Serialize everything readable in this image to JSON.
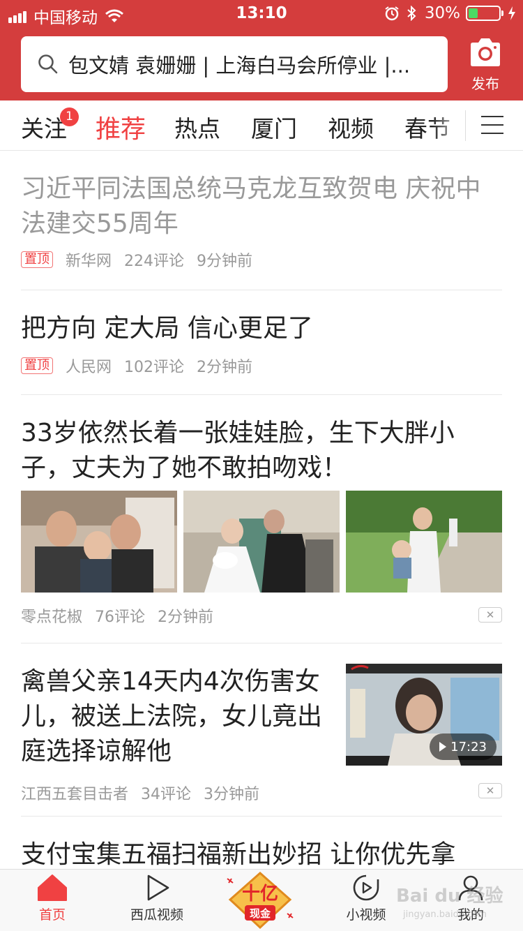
{
  "status_bar": {
    "carrier": "中国移动",
    "time": "13:10",
    "battery": "30%"
  },
  "header": {
    "search_text": "包文婧 袁姗姗 | 上海白马会所停业 |...",
    "publish_label": "发布"
  },
  "channels": {
    "items": [
      "关注",
      "推荐",
      "热点",
      "厦门",
      "视频",
      "春节"
    ],
    "active": "推荐",
    "follow_badge": "1"
  },
  "feed": [
    {
      "title": "习近平同法国总统马克龙互致贺电 庆祝中法建交55周年",
      "tag": "置顶",
      "source": "新华网",
      "comments": "224评论",
      "time": "9分钟前",
      "read": true
    },
    {
      "title": "把方向 定大局 信心更足了",
      "tag": "置顶",
      "source": "人民网",
      "comments": "102评论",
      "time": "2分钟前"
    },
    {
      "title": "33岁依然长着一张娃娃脸，生下大胖小子，丈夫为了她不敢拍吻戏！",
      "source": "零点花椒",
      "comments": "76评论",
      "time": "2分钟前",
      "images": 3
    },
    {
      "title": "禽兽父亲14天内4次伤害女儿，被送上法院，女儿竟出庭选择谅解他",
      "source": "江西五套目击者",
      "comments": "34评论",
      "time": "3分钟前",
      "video_duration": "17:23"
    },
    {
      "title": "支付宝集五福扫福新出妙招 让你优先拿"
    }
  ],
  "tabbar": {
    "items": [
      "首页",
      "西瓜视频",
      "小视频",
      "我的"
    ],
    "active": "首页",
    "promo_text": [
      "十亿",
      "现金"
    ]
  },
  "watermark": {
    "text": "Bai du 经验",
    "sub": "jingyan.baidu.com"
  },
  "colors": {
    "brand_red": "#d43d3d",
    "accent_red": "#f04142"
  }
}
